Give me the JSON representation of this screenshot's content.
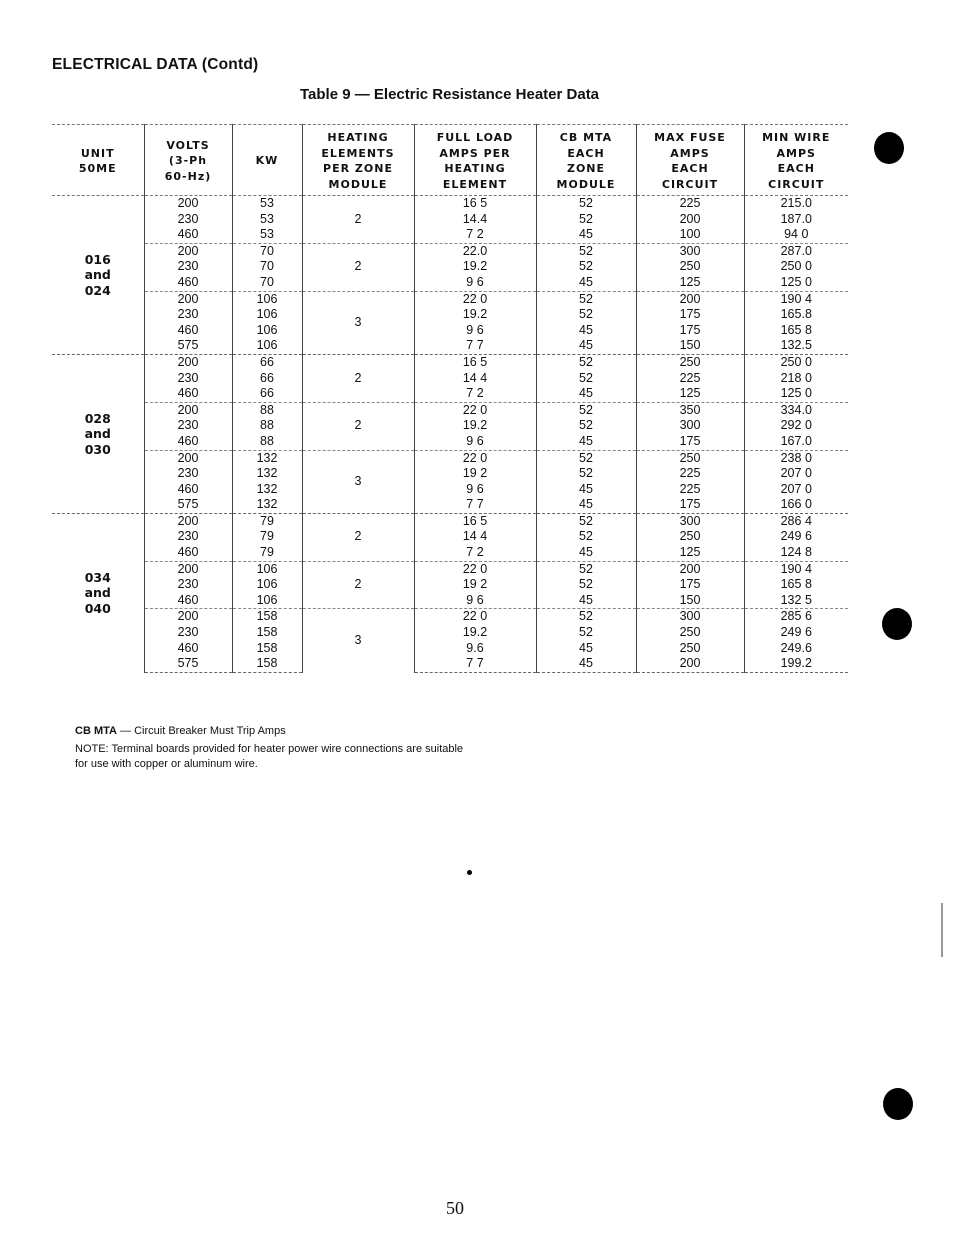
{
  "page": {
    "section_title": "ELECTRICAL DATA (Contd)",
    "table_title": "Table 9 — Electric Resistance Heater Data",
    "page_number": "50"
  },
  "table": {
    "headers": [
      "UNIT\n50ME",
      "VOLTS\n(3-Ph\n60-Hz)",
      "KW",
      "HEATING\nELEMENTS\nPER ZONE\nMODULE",
      "FULL LOAD\nAMPS PER\nHEATING\nELEMENT",
      "CB MTA\nEACH\nZONE\nMODULE",
      "MAX FUSE\nAMPS\nEACH\nCIRCUIT",
      "MIN WIRE\nAMPS\nEACH\nCIRCUIT"
    ],
    "units": [
      {
        "label": "016\nand\n024",
        "groups": [
          {
            "elements": "2",
            "rows": [
              {
                "volts": "200",
                "kw": "53",
                "fla": "16 5",
                "cb": "52",
                "fuse": "225",
                "wire": "215.0"
              },
              {
                "volts": "230",
                "kw": "53",
                "fla": "14.4",
                "cb": "52",
                "fuse": "200",
                "wire": "187.0"
              },
              {
                "volts": "460",
                "kw": "53",
                "fla": "7 2",
                "cb": "45",
                "fuse": "100",
                "wire": "94 0"
              }
            ]
          },
          {
            "elements": "2",
            "rows": [
              {
                "volts": "200",
                "kw": "70",
                "fla": "22.0",
                "cb": "52",
                "fuse": "300",
                "wire": "287.0"
              },
              {
                "volts": "230",
                "kw": "70",
                "fla": "19.2",
                "cb": "52",
                "fuse": "250",
                "wire": "250 0"
              },
              {
                "volts": "460",
                "kw": "70",
                "fla": "9 6",
                "cb": "45",
                "fuse": "125",
                "wire": "125 0"
              }
            ]
          },
          {
            "elements": "3",
            "rows": [
              {
                "volts": "200",
                "kw": "106",
                "fla": "22 0",
                "cb": "52",
                "fuse": "200",
                "wire": "190 4"
              },
              {
                "volts": "230",
                "kw": "106",
                "fla": "19.2",
                "cb": "52",
                "fuse": "175",
                "wire": "165.8"
              },
              {
                "volts": "460",
                "kw": "106",
                "fla": "9 6",
                "cb": "45",
                "fuse": "175",
                "wire": "165 8"
              },
              {
                "volts": "575",
                "kw": "106",
                "fla": "7 7",
                "cb": "45",
                "fuse": "150",
                "wire": "132.5"
              }
            ]
          }
        ]
      },
      {
        "label": "028\nand\n030",
        "groups": [
          {
            "elements": "2",
            "rows": [
              {
                "volts": "200",
                "kw": "66",
                "fla": "16 5",
                "cb": "52",
                "fuse": "250",
                "wire": "250 0"
              },
              {
                "volts": "230",
                "kw": "66",
                "fla": "14 4",
                "cb": "52",
                "fuse": "225",
                "wire": "218 0"
              },
              {
                "volts": "460",
                "kw": "66",
                "fla": "7 2",
                "cb": "45",
                "fuse": "125",
                "wire": "125 0"
              }
            ]
          },
          {
            "elements": "2",
            "rows": [
              {
                "volts": "200",
                "kw": "88",
                "fla": "22 0",
                "cb": "52",
                "fuse": "350",
                "wire": "334.0"
              },
              {
                "volts": "230",
                "kw": "88",
                "fla": "19.2",
                "cb": "52",
                "fuse": "300",
                "wire": "292 0"
              },
              {
                "volts": "460",
                "kw": "88",
                "fla": "9 6",
                "cb": "45",
                "fuse": "175",
                "wire": "167.0"
              }
            ]
          },
          {
            "elements": "3",
            "rows": [
              {
                "volts": "200",
                "kw": "132",
                "fla": "22 0",
                "cb": "52",
                "fuse": "250",
                "wire": "238 0"
              },
              {
                "volts": "230",
                "kw": "132",
                "fla": "19 2",
                "cb": "52",
                "fuse": "225",
                "wire": "207 0"
              },
              {
                "volts": "460",
                "kw": "132",
                "fla": "9 6",
                "cb": "45",
                "fuse": "225",
                "wire": "207 0"
              },
              {
                "volts": "575",
                "kw": "132",
                "fla": "7 7",
                "cb": "45",
                "fuse": "175",
                "wire": "166 0"
              }
            ]
          }
        ]
      },
      {
        "label": "034\nand\n040",
        "groups": [
          {
            "elements": "2",
            "rows": [
              {
                "volts": "200",
                "kw": "79",
                "fla": "16 5",
                "cb": "52",
                "fuse": "300",
                "wire": "286 4"
              },
              {
                "volts": "230",
                "kw": "79",
                "fla": "14 4",
                "cb": "52",
                "fuse": "250",
                "wire": "249 6"
              },
              {
                "volts": "460",
                "kw": "79",
                "fla": "7 2",
                "cb": "45",
                "fuse": "125",
                "wire": "124 8"
              }
            ]
          },
          {
            "elements": "2",
            "rows": [
              {
                "volts": "200",
                "kw": "106",
                "fla": "22 0",
                "cb": "52",
                "fuse": "200",
                "wire": "190 4"
              },
              {
                "volts": "230",
                "kw": "106",
                "fla": "19 2",
                "cb": "52",
                "fuse": "175",
                "wire": "165 8"
              },
              {
                "volts": "460",
                "kw": "106",
                "fla": "9 6",
                "cb": "45",
                "fuse": "150",
                "wire": "132 5"
              }
            ]
          },
          {
            "elements": "3",
            "rows": [
              {
                "volts": "200",
                "kw": "158",
                "fla": "22 0",
                "cb": "52",
                "fuse": "300",
                "wire": "285 6"
              },
              {
                "volts": "230",
                "kw": "158",
                "fla": "19.2",
                "cb": "52",
                "fuse": "250",
                "wire": "249 6"
              },
              {
                "volts": "460",
                "kw": "158",
                "fla": "9.6",
                "cb": "45",
                "fuse": "250",
                "wire": "249.6"
              },
              {
                "volts": "575",
                "kw": "158",
                "fla": "7 7",
                "cb": "45",
                "fuse": "200",
                "wire": "199.2"
              }
            ]
          }
        ]
      }
    ]
  },
  "footnotes": {
    "abbrev_term": "CB MTA",
    "abbrev_sep": " — ",
    "abbrev_def": "Circuit Breaker Must Trip Amps",
    "note": "NOTE: Terminal boards provided for heater power wire connections are suitable for use with copper or aluminum wire."
  }
}
